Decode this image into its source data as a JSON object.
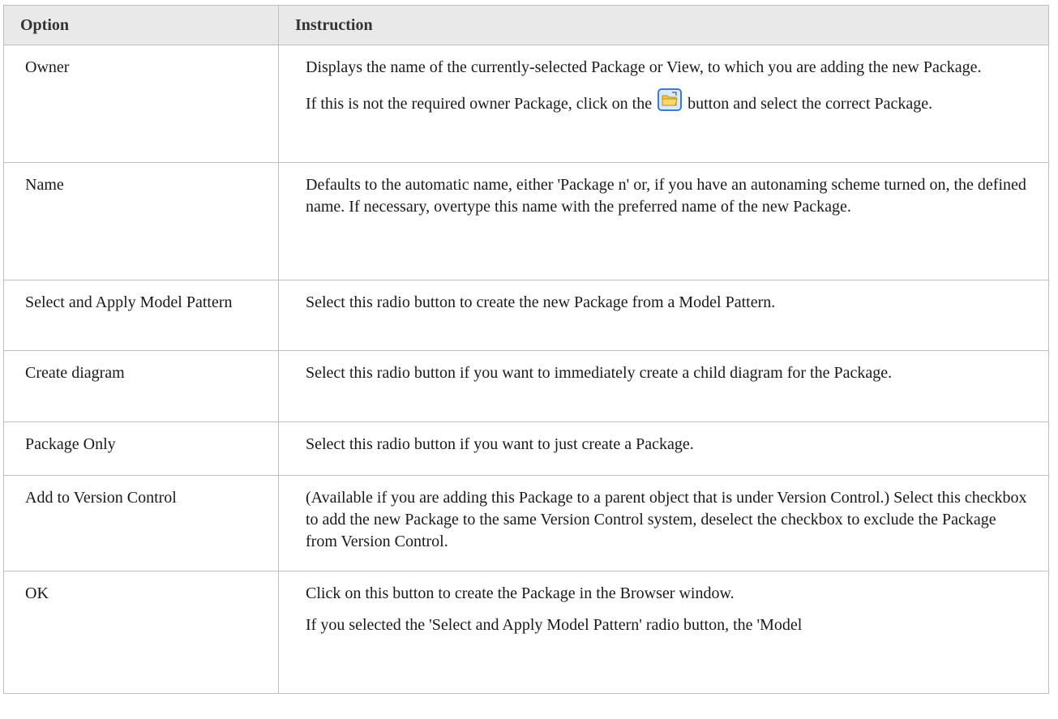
{
  "table": {
    "header": {
      "option": "Option",
      "instruction": "Instruction"
    },
    "rows": [
      {
        "option": "Owner",
        "p1": "Displays the name of the currently-selected Package or View, to which you are adding the new Package.",
        "p2_before": "If this is not the required owner Package, click on the",
        "p2_after": "button and select the correct Package."
      },
      {
        "option": "Name",
        "p1": "Defaults to the automatic name, either 'Package n' or, if you have an autonaming scheme turned on, the defined name. If necessary, overtype this name with the preferred name of the new Package."
      },
      {
        "option": "Select and Apply Model Pattern",
        "p1": "Select this radio button to create the new Package from a Model Pattern."
      },
      {
        "option": "Create diagram",
        "p1": "Select this radio button if you want to immediately create a child diagram for the Package."
      },
      {
        "option": "Package Only",
        "p1": "Select this radio button if you want to just create a Package."
      },
      {
        "option": "Add to Version Control",
        "p1": "(Available if you are adding this Package to a parent object that is under Version Control.) Select this checkbox to add the new Package to the same Version Control system, deselect the checkbox to exclude the Package from Version Control."
      },
      {
        "option": "OK",
        "p1": "Click on this button to create the Package in the Browser window.",
        "p2": "If you selected the 'Select and Apply Model Pattern' radio button, the 'Model"
      }
    ]
  },
  "icons": {
    "owner_browse_button": "open-folder-icon"
  },
  "colors": {
    "header_bg": "#e9e9e9",
    "border": "#bfbfbf",
    "icon_frame": "#3a7bd5",
    "icon_folder": "#f2c84b"
  }
}
